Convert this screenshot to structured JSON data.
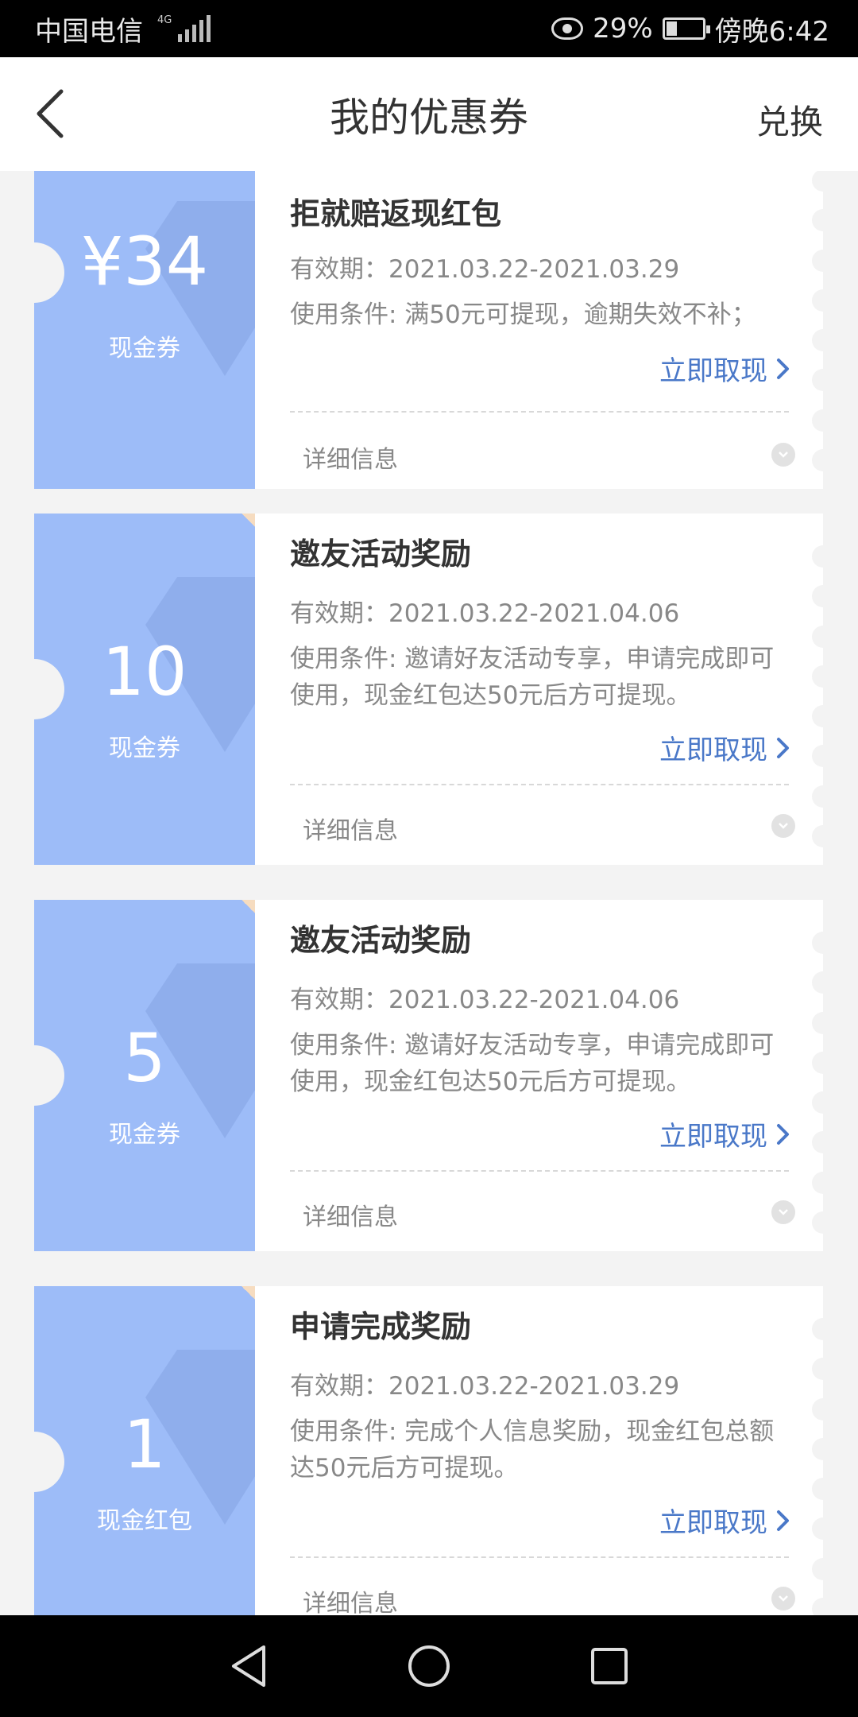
{
  "status_bar": {
    "carrier": "中国电信",
    "network": "4G",
    "battery": "29%",
    "time": "傍晚6:42"
  },
  "header": {
    "title": "我的优惠券",
    "action_label": "兑换"
  },
  "coupons": [
    {
      "amount": "¥34",
      "type_label": "现金券",
      "title": "拒就赔返现红包",
      "validity": "有效期：2021.03.22-2021.03.29",
      "condition": "使用条件: 满50元可提现，逾期失效不补；",
      "action_label": "立即取现",
      "details_label": "详细信息"
    },
    {
      "amount": "10",
      "type_label": "现金券",
      "title": "邀友活动奖励",
      "validity": "有效期：2021.03.22-2021.04.06",
      "condition": "使用条件: 邀请好友活动专享，申请完成即可使用，现金红包达50元后方可提现。",
      "action_label": "立即取现",
      "details_label": "详细信息"
    },
    {
      "amount": "5",
      "type_label": "现金券",
      "title": "邀友活动奖励",
      "validity": "有效期：2021.03.22-2021.04.06",
      "condition": "使用条件: 邀请好友活动专享，申请完成即可使用，现金红包达50元后方可提现。",
      "action_label": "立即取现",
      "details_label": "详细信息"
    },
    {
      "amount": "1",
      "type_label": "现金红包",
      "title": "申请完成奖励",
      "validity": "有效期：2021.03.22-2021.03.29",
      "condition": "使用条件: 完成个人信息奖励，现金红包总额达50元后方可提现。",
      "action_label": "立即取现",
      "details_label": "详细信息"
    }
  ],
  "colors": {
    "coupon_accent": "#9dbcf8",
    "link": "#4a78c8",
    "background": "#f3f3f3"
  },
  "icons": {
    "back": "chevron-left-icon",
    "claim": "chevron-right-icon",
    "details": "chevron-down-icon",
    "nav_back": "triangle-back-icon",
    "nav_home": "circle-home-icon",
    "nav_recent": "square-recent-icon"
  }
}
